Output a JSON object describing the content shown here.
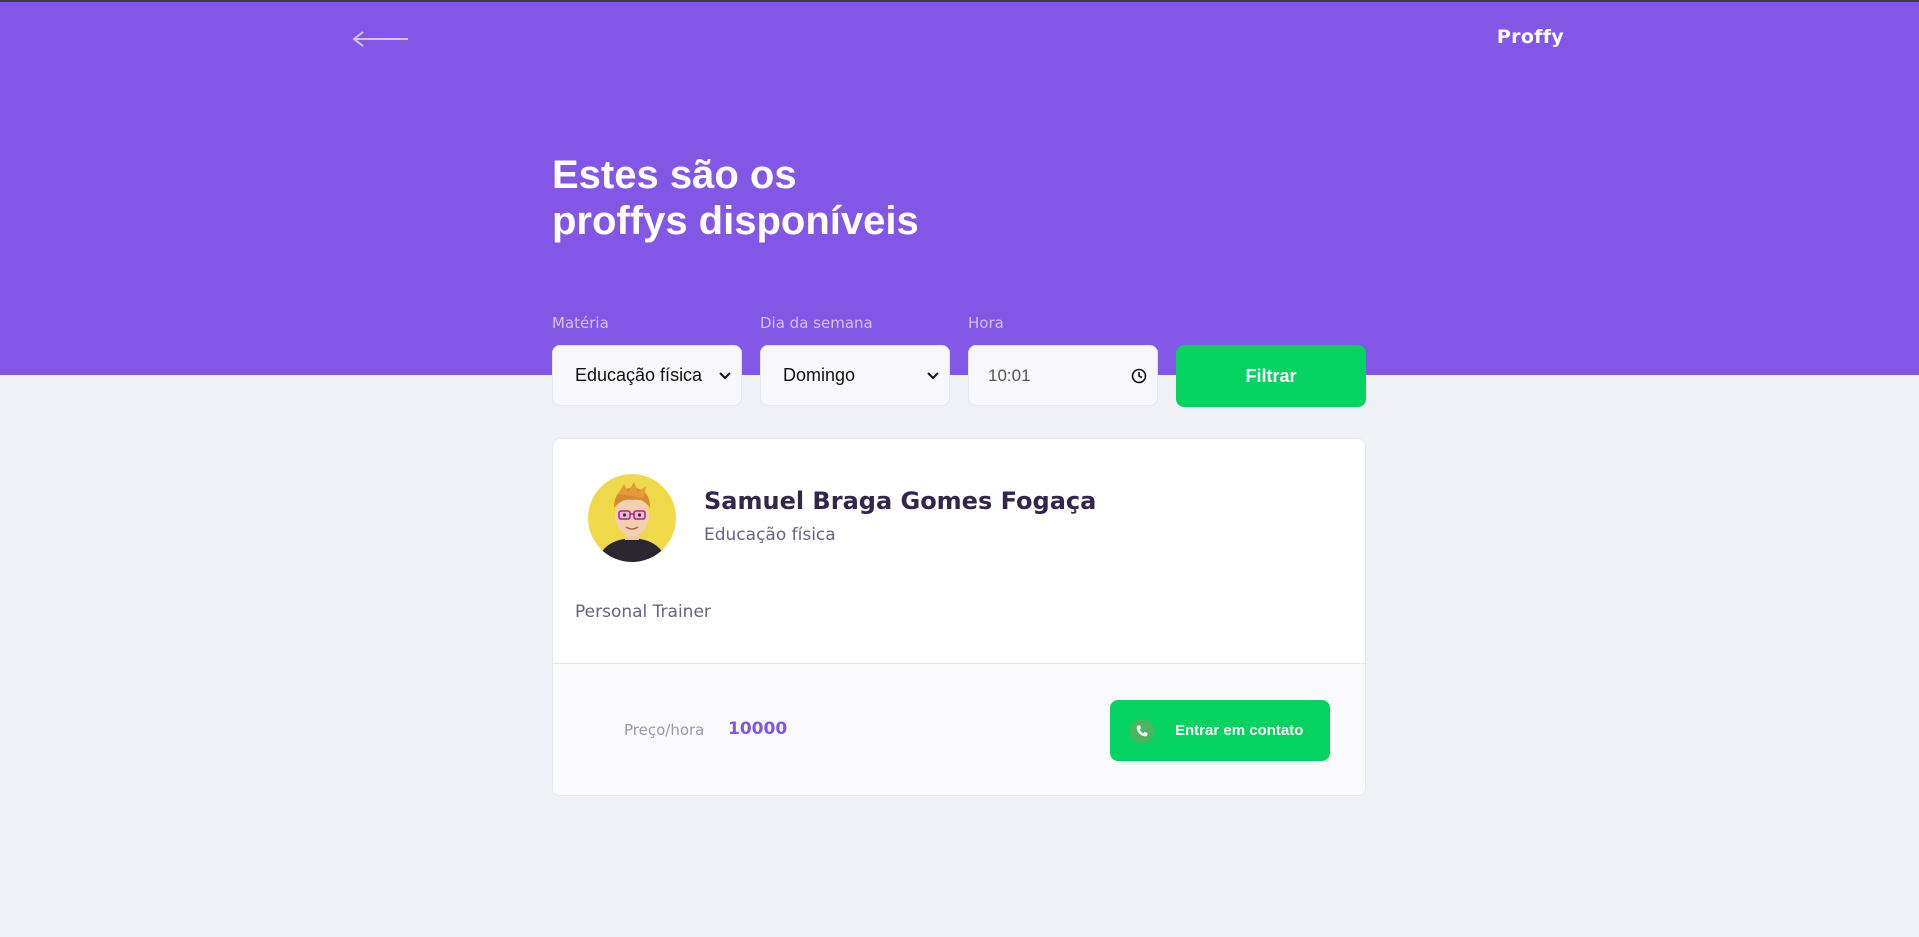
{
  "header": {
    "logo": "Proffy",
    "back_icon": "arrow-left-icon",
    "title_line1": "Estes são os",
    "title_line2": "proffys disponíveis",
    "background_color": "#8257e5"
  },
  "filters": {
    "subject": {
      "label": "Matéria",
      "value": "Educação física"
    },
    "weekday": {
      "label": "Dia da semana",
      "value": "Domingo"
    },
    "time": {
      "label": "Hora",
      "value": "10:01"
    },
    "submit_label": "Filtrar"
  },
  "teachers": [
    {
      "name": "Samuel Braga Gomes Fogaça",
      "subject": "Educação física",
      "bio": "Personal Trainer",
      "price_label": "Preço/hora",
      "price": "10000",
      "contact_label": "Entrar em contato",
      "contact_icon": "whatsapp-icon"
    }
  ],
  "colors": {
    "primary": "#8257e5",
    "secondary": "#04d361",
    "background": "#f0f0f7"
  }
}
